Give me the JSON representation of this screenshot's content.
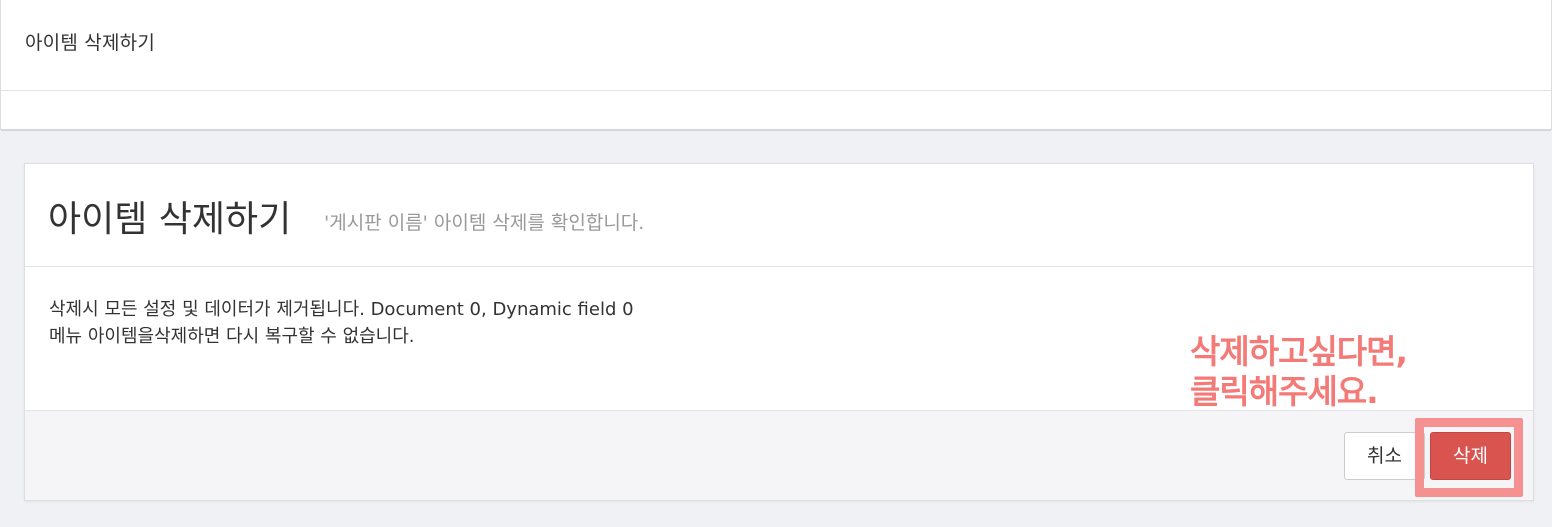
{
  "header": {
    "title": "아이템 삭제하기"
  },
  "panel": {
    "title": "아이템 삭제하기",
    "subtitle": "'게시판 이름' 아이템 삭제를 확인합니다.",
    "body": {
      "line1": "삭제시 모든 설정 및 데이터가 제거됩니다. Document 0, Dynamic field 0",
      "line2": "메뉴 아이템을삭제하면 다시 복구할 수 없습니다."
    },
    "annotation": {
      "line1": "삭제하고싶다면,",
      "line2": "클릭해주세요."
    },
    "footer": {
      "cancel_label": "취소",
      "delete_label": "삭제"
    }
  },
  "colors": {
    "danger": "#d9534f",
    "annotation": "#f47a78",
    "highlight": "#f69192",
    "background": "#f0f1f4"
  }
}
